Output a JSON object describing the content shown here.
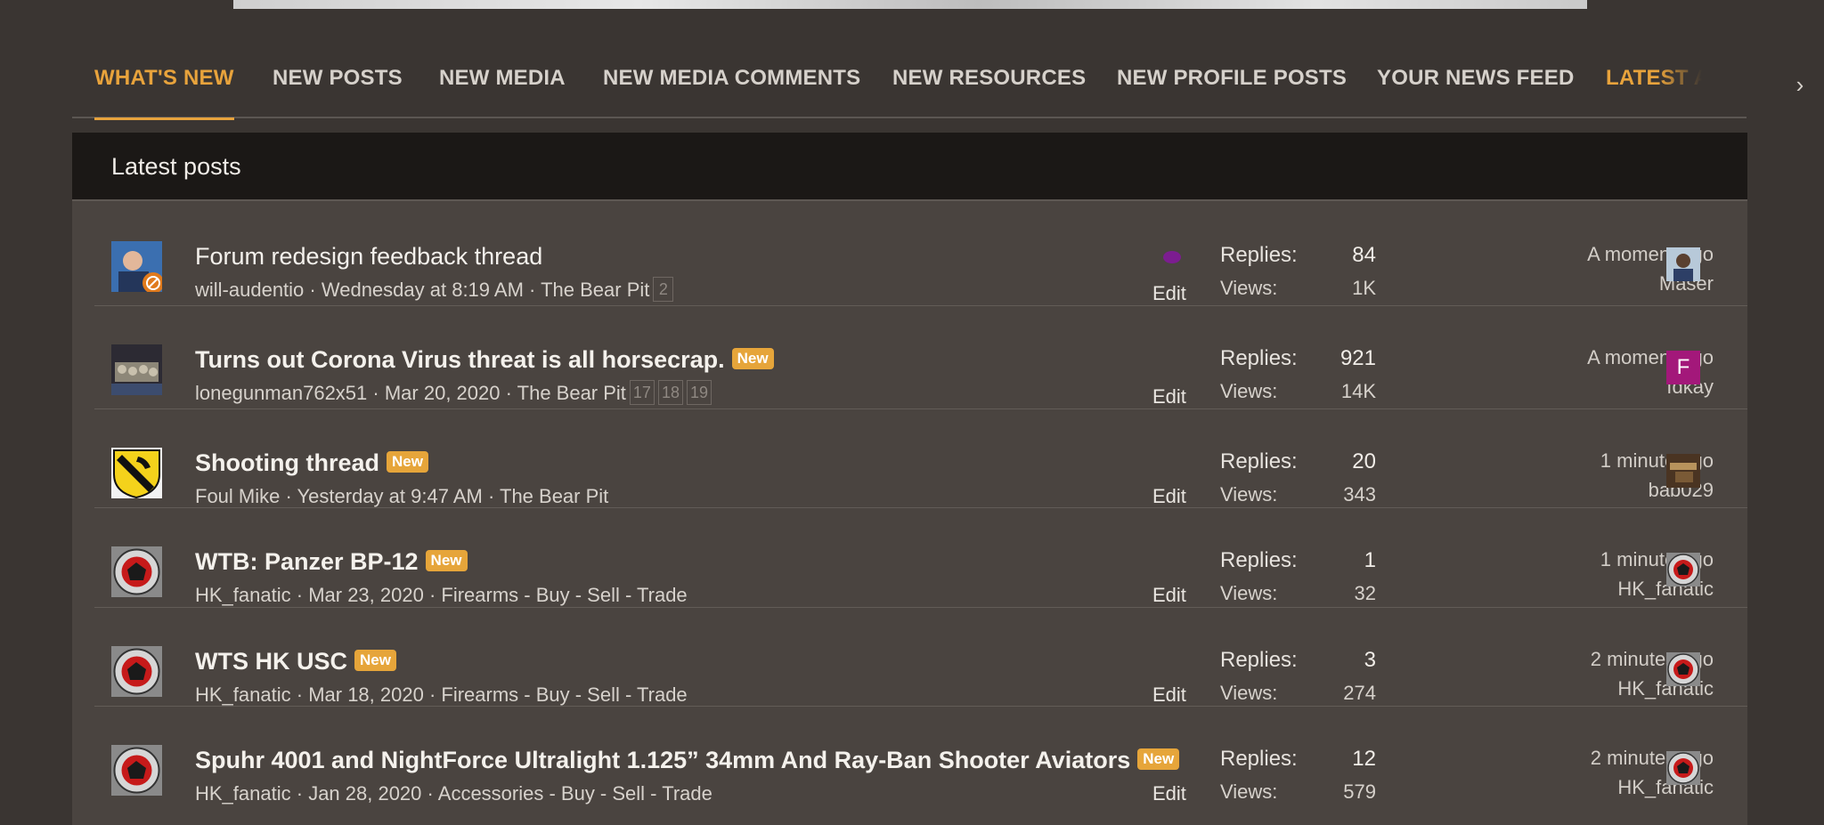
{
  "tabs": {
    "whats_new": "WHAT'S NEW",
    "new_posts": "NEW POSTS",
    "new_media": "NEW MEDIA",
    "new_media_comments": "NEW MEDIA COMMENTS",
    "new_resources": "NEW RESOURCES",
    "new_profile_posts": "NEW PROFILE POSTS",
    "your_news_feed": "YOUR NEWS FEED",
    "latest": "LATEST ACTIVITY",
    "arrow": "›"
  },
  "block": {
    "title": "Latest posts"
  },
  "labels": {
    "replies": "Replies:",
    "views": "Views:",
    "edit": "Edit",
    "new": "New"
  },
  "threads": [
    {
      "title": "Forum redesign feedback thread",
      "author": "will-audentio",
      "date": "Wednesday at 8:19 AM",
      "forum": "The Bear Pit",
      "pages": [
        "2"
      ],
      "replies": "84",
      "views": "1K",
      "last_time": "A moment ago",
      "last_user": "Maser",
      "is_new": false
    },
    {
      "title": "Turns out Corona Virus threat is all horsecrap.",
      "author": "lonegunman762x51",
      "date": "Mar 20, 2020",
      "forum": "The Bear Pit",
      "pages": [
        "17",
        "18",
        "19"
      ],
      "replies": "921",
      "views": "14K",
      "last_time": "A moment ago",
      "last_user": "fdkay",
      "last_avatar_letter": "F",
      "is_new": true
    },
    {
      "title": "Shooting thread",
      "author": "Foul Mike",
      "date": "Yesterday at 9:47 AM",
      "forum": "The Bear Pit",
      "pages": [],
      "replies": "20",
      "views": "343",
      "last_time": "1 minute ago",
      "last_user": "bab029",
      "is_new": true
    },
    {
      "title": "WTB: Panzer BP-12",
      "author": "HK_fanatic",
      "date": "Mar 23, 2020",
      "forum": "Firearms - Buy - Sell - Trade",
      "pages": [],
      "replies": "1",
      "views": "32",
      "last_time": "1 minute ago",
      "last_user": "HK_fanatic",
      "is_new": true
    },
    {
      "title": "WTS HK USC",
      "author": "HK_fanatic",
      "date": "Mar 18, 2020",
      "forum": "Firearms - Buy - Sell - Trade",
      "pages": [],
      "replies": "3",
      "views": "274",
      "last_time": "2 minutes ago",
      "last_user": "HK_fanatic",
      "is_new": true
    },
    {
      "title": "Spuhr 4001 and NightForce Ultralight 1.125” 34mm And Ray-Ban Shooter Aviators",
      "author": "HK_fanatic",
      "date": "Jan 28, 2020",
      "forum": "Accessories - Buy - Sell - Trade",
      "pages": [],
      "replies": "12",
      "views": "579",
      "last_time": "2 minutes ago",
      "last_user": "HK_fanatic",
      "is_new": true
    }
  ],
  "sep": " · ",
  "colors": {
    "accent": "#e8a33c",
    "badge": "#e6a53a",
    "bg": "#3a3532",
    "panel": "#4a4440",
    "header": "#1b1816"
  }
}
